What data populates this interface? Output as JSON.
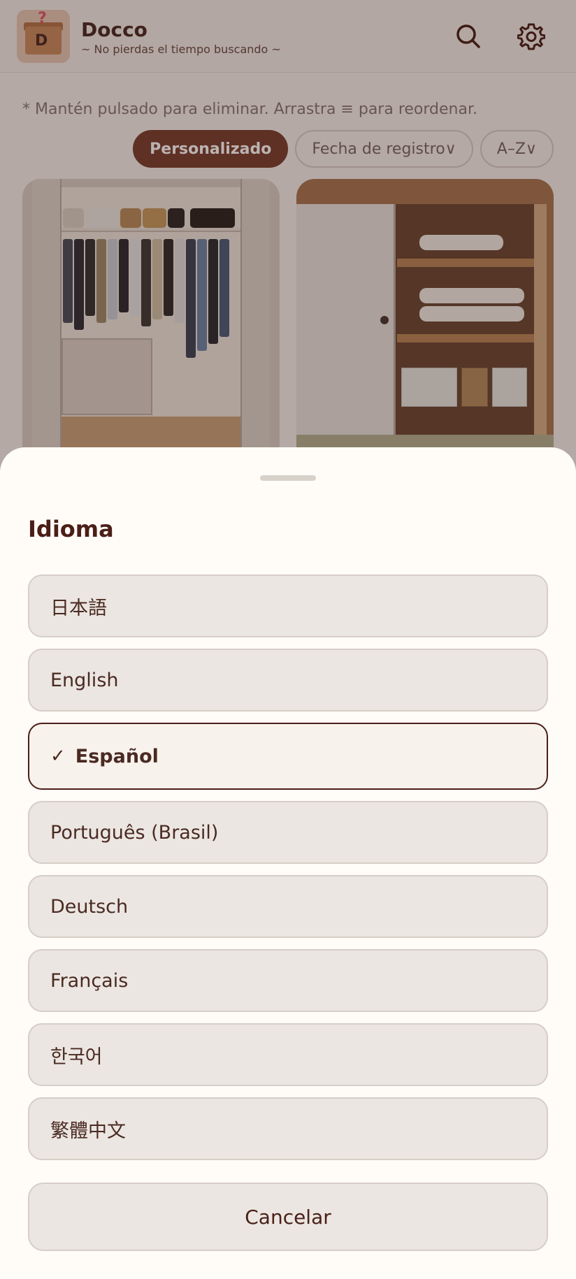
{
  "header": {
    "app_name": "Docco",
    "tagline": "~ No pierdas el tiempo buscando ~",
    "search_icon": "search-icon",
    "settings_icon": "gear-icon"
  },
  "hint": "* Mantén pulsado para eliminar. Arrastra ≡ para reordenar.",
  "sort_options": [
    {
      "label": "Personalizado",
      "active": true
    },
    {
      "label": "Fecha de registro∨",
      "active": false
    },
    {
      "label": "A–Z∨",
      "active": false
    }
  ],
  "language_sheet": {
    "title": "Idioma",
    "languages": [
      {
        "label": "日本語",
        "selected": false
      },
      {
        "label": "English",
        "selected": false
      },
      {
        "label": "Español",
        "selected": true,
        "check": "✓"
      },
      {
        "label": "Português (Brasil)",
        "selected": false
      },
      {
        "label": "Deutsch",
        "selected": false
      },
      {
        "label": "Français",
        "selected": false
      },
      {
        "label": "한국어",
        "selected": false
      },
      {
        "label": "繁體中文",
        "selected": false
      }
    ],
    "cancel_label": "Cancelar"
  },
  "colors": {
    "accent": "#7a3f2f",
    "text_dark": "#4a1f18",
    "sheet_bg": "#fffcf8",
    "option_bg": "#ebe6e1"
  }
}
